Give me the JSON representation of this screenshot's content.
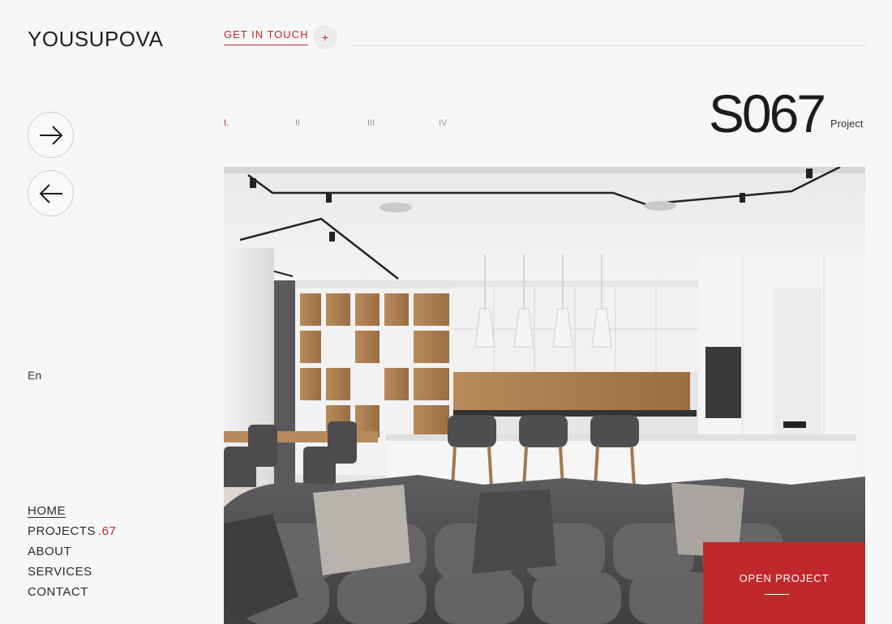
{
  "brand": {
    "logo": "YOUSUPOVA"
  },
  "header": {
    "cta_label": "GET IN TOUCH",
    "plus_glyph": "+"
  },
  "side": {
    "language": "En"
  },
  "nav": {
    "items": [
      {
        "label": "HOME",
        "active": true
      },
      {
        "label": "PROJECTS",
        "count": ".67"
      },
      {
        "label": "ABOUT"
      },
      {
        "label": "SERVICES"
      },
      {
        "label": "CONTACT"
      }
    ]
  },
  "slider": {
    "pages": [
      "I.",
      "II",
      "III",
      "IV"
    ],
    "active_index": 0
  },
  "project": {
    "number": "S067",
    "label": "Project"
  },
  "hero": {
    "image": "interior-kitchen-living-room-photo",
    "cta_label": "OPEN PROJECT"
  },
  "colors": {
    "accent": "#c0282b",
    "background": "#f7f7f7"
  },
  "icons": {
    "next": "arrow-right-icon",
    "prev": "arrow-left-icon"
  }
}
